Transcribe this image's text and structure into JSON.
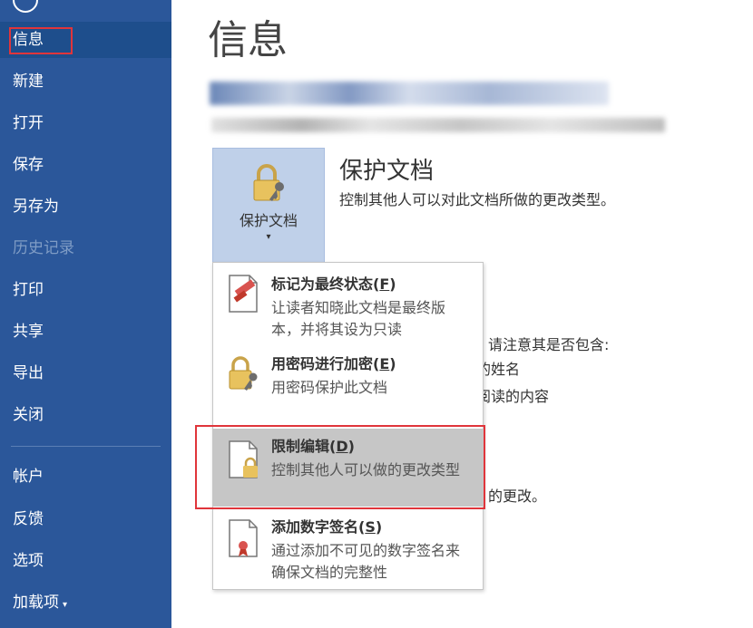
{
  "sidebar": {
    "items": [
      {
        "label": "信息"
      },
      {
        "label": "新建"
      },
      {
        "label": "打开"
      },
      {
        "label": "保存"
      },
      {
        "label": "另存为"
      },
      {
        "label": "历史记录"
      },
      {
        "label": "打印"
      },
      {
        "label": "共享"
      },
      {
        "label": "导出"
      },
      {
        "label": "关闭"
      },
      {
        "label": "帐户"
      },
      {
        "label": "反馈"
      },
      {
        "label": "选项"
      },
      {
        "label": "加载项"
      }
    ]
  },
  "main": {
    "title": "信息",
    "protect": {
      "button_label": "保护文档",
      "heading": "保护文档",
      "description": "控制其他人可以对此文档所做的更改类型。"
    },
    "background_text": {
      "inspect_line": "请注意其是否包含:",
      "name_line": "的姓名",
      "content_line": "阅读的内容",
      "changes_line": "的更改。"
    }
  },
  "dropdown": {
    "items": [
      {
        "title_pre": "标记为最终状态(",
        "hotkey": "F",
        "title_post": ")",
        "desc": "让读者知晓此文档是最终版本，并将其设为只读"
      },
      {
        "title_pre": "用密码进行加密(",
        "hotkey": "E",
        "title_post": ")",
        "desc": "用密码保护此文档"
      },
      {
        "title_pre": "限制编辑(",
        "hotkey": "D",
        "title_post": ")",
        "desc": "控制其他人可以做的更改类型"
      },
      {
        "title_pre": "添加数字签名(",
        "hotkey": "S",
        "title_post": ")",
        "desc": "通过添加不可见的数字签名来确保文档的完整性"
      }
    ]
  },
  "colors": {
    "sidebar_bg": "#2b579a",
    "highlight_red": "#e0353b",
    "protect_button_bg": "#bfd0e9"
  }
}
